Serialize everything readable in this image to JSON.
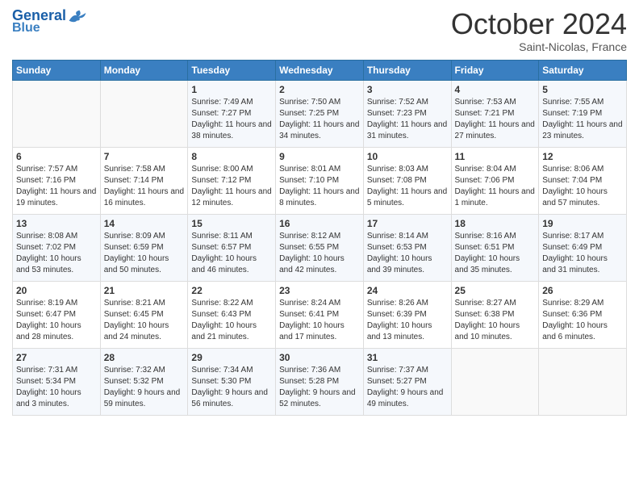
{
  "header": {
    "logo_general": "General",
    "logo_blue": "Blue",
    "month": "October 2024",
    "location": "Saint-Nicolas, France"
  },
  "days_of_week": [
    "Sunday",
    "Monday",
    "Tuesday",
    "Wednesday",
    "Thursday",
    "Friday",
    "Saturday"
  ],
  "weeks": [
    [
      {
        "day": "",
        "sunrise": "",
        "sunset": "",
        "daylight": ""
      },
      {
        "day": "",
        "sunrise": "",
        "sunset": "",
        "daylight": ""
      },
      {
        "day": "1",
        "sunrise": "Sunrise: 7:49 AM",
        "sunset": "Sunset: 7:27 PM",
        "daylight": "Daylight: 11 hours and 38 minutes."
      },
      {
        "day": "2",
        "sunrise": "Sunrise: 7:50 AM",
        "sunset": "Sunset: 7:25 PM",
        "daylight": "Daylight: 11 hours and 34 minutes."
      },
      {
        "day": "3",
        "sunrise": "Sunrise: 7:52 AM",
        "sunset": "Sunset: 7:23 PM",
        "daylight": "Daylight: 11 hours and 31 minutes."
      },
      {
        "day": "4",
        "sunrise": "Sunrise: 7:53 AM",
        "sunset": "Sunset: 7:21 PM",
        "daylight": "Daylight: 11 hours and 27 minutes."
      },
      {
        "day": "5",
        "sunrise": "Sunrise: 7:55 AM",
        "sunset": "Sunset: 7:19 PM",
        "daylight": "Daylight: 11 hours and 23 minutes."
      }
    ],
    [
      {
        "day": "6",
        "sunrise": "Sunrise: 7:57 AM",
        "sunset": "Sunset: 7:16 PM",
        "daylight": "Daylight: 11 hours and 19 minutes."
      },
      {
        "day": "7",
        "sunrise": "Sunrise: 7:58 AM",
        "sunset": "Sunset: 7:14 PM",
        "daylight": "Daylight: 11 hours and 16 minutes."
      },
      {
        "day": "8",
        "sunrise": "Sunrise: 8:00 AM",
        "sunset": "Sunset: 7:12 PM",
        "daylight": "Daylight: 11 hours and 12 minutes."
      },
      {
        "day": "9",
        "sunrise": "Sunrise: 8:01 AM",
        "sunset": "Sunset: 7:10 PM",
        "daylight": "Daylight: 11 hours and 8 minutes."
      },
      {
        "day": "10",
        "sunrise": "Sunrise: 8:03 AM",
        "sunset": "Sunset: 7:08 PM",
        "daylight": "Daylight: 11 hours and 5 minutes."
      },
      {
        "day": "11",
        "sunrise": "Sunrise: 8:04 AM",
        "sunset": "Sunset: 7:06 PM",
        "daylight": "Daylight: 11 hours and 1 minute."
      },
      {
        "day": "12",
        "sunrise": "Sunrise: 8:06 AM",
        "sunset": "Sunset: 7:04 PM",
        "daylight": "Daylight: 10 hours and 57 minutes."
      }
    ],
    [
      {
        "day": "13",
        "sunrise": "Sunrise: 8:08 AM",
        "sunset": "Sunset: 7:02 PM",
        "daylight": "Daylight: 10 hours and 53 minutes."
      },
      {
        "day": "14",
        "sunrise": "Sunrise: 8:09 AM",
        "sunset": "Sunset: 6:59 PM",
        "daylight": "Daylight: 10 hours and 50 minutes."
      },
      {
        "day": "15",
        "sunrise": "Sunrise: 8:11 AM",
        "sunset": "Sunset: 6:57 PM",
        "daylight": "Daylight: 10 hours and 46 minutes."
      },
      {
        "day": "16",
        "sunrise": "Sunrise: 8:12 AM",
        "sunset": "Sunset: 6:55 PM",
        "daylight": "Daylight: 10 hours and 42 minutes."
      },
      {
        "day": "17",
        "sunrise": "Sunrise: 8:14 AM",
        "sunset": "Sunset: 6:53 PM",
        "daylight": "Daylight: 10 hours and 39 minutes."
      },
      {
        "day": "18",
        "sunrise": "Sunrise: 8:16 AM",
        "sunset": "Sunset: 6:51 PM",
        "daylight": "Daylight: 10 hours and 35 minutes."
      },
      {
        "day": "19",
        "sunrise": "Sunrise: 8:17 AM",
        "sunset": "Sunset: 6:49 PM",
        "daylight": "Daylight: 10 hours and 31 minutes."
      }
    ],
    [
      {
        "day": "20",
        "sunrise": "Sunrise: 8:19 AM",
        "sunset": "Sunset: 6:47 PM",
        "daylight": "Daylight: 10 hours and 28 minutes."
      },
      {
        "day": "21",
        "sunrise": "Sunrise: 8:21 AM",
        "sunset": "Sunset: 6:45 PM",
        "daylight": "Daylight: 10 hours and 24 minutes."
      },
      {
        "day": "22",
        "sunrise": "Sunrise: 8:22 AM",
        "sunset": "Sunset: 6:43 PM",
        "daylight": "Daylight: 10 hours and 21 minutes."
      },
      {
        "day": "23",
        "sunrise": "Sunrise: 8:24 AM",
        "sunset": "Sunset: 6:41 PM",
        "daylight": "Daylight: 10 hours and 17 minutes."
      },
      {
        "day": "24",
        "sunrise": "Sunrise: 8:26 AM",
        "sunset": "Sunset: 6:39 PM",
        "daylight": "Daylight: 10 hours and 13 minutes."
      },
      {
        "day": "25",
        "sunrise": "Sunrise: 8:27 AM",
        "sunset": "Sunset: 6:38 PM",
        "daylight": "Daylight: 10 hours and 10 minutes."
      },
      {
        "day": "26",
        "sunrise": "Sunrise: 8:29 AM",
        "sunset": "Sunset: 6:36 PM",
        "daylight": "Daylight: 10 hours and 6 minutes."
      }
    ],
    [
      {
        "day": "27",
        "sunrise": "Sunrise: 7:31 AM",
        "sunset": "Sunset: 5:34 PM",
        "daylight": "Daylight: 10 hours and 3 minutes."
      },
      {
        "day": "28",
        "sunrise": "Sunrise: 7:32 AM",
        "sunset": "Sunset: 5:32 PM",
        "daylight": "Daylight: 9 hours and 59 minutes."
      },
      {
        "day": "29",
        "sunrise": "Sunrise: 7:34 AM",
        "sunset": "Sunset: 5:30 PM",
        "daylight": "Daylight: 9 hours and 56 minutes."
      },
      {
        "day": "30",
        "sunrise": "Sunrise: 7:36 AM",
        "sunset": "Sunset: 5:28 PM",
        "daylight": "Daylight: 9 hours and 52 minutes."
      },
      {
        "day": "31",
        "sunrise": "Sunrise: 7:37 AM",
        "sunset": "Sunset: 5:27 PM",
        "daylight": "Daylight: 9 hours and 49 minutes."
      },
      {
        "day": "",
        "sunrise": "",
        "sunset": "",
        "daylight": ""
      },
      {
        "day": "",
        "sunrise": "",
        "sunset": "",
        "daylight": ""
      }
    ]
  ]
}
